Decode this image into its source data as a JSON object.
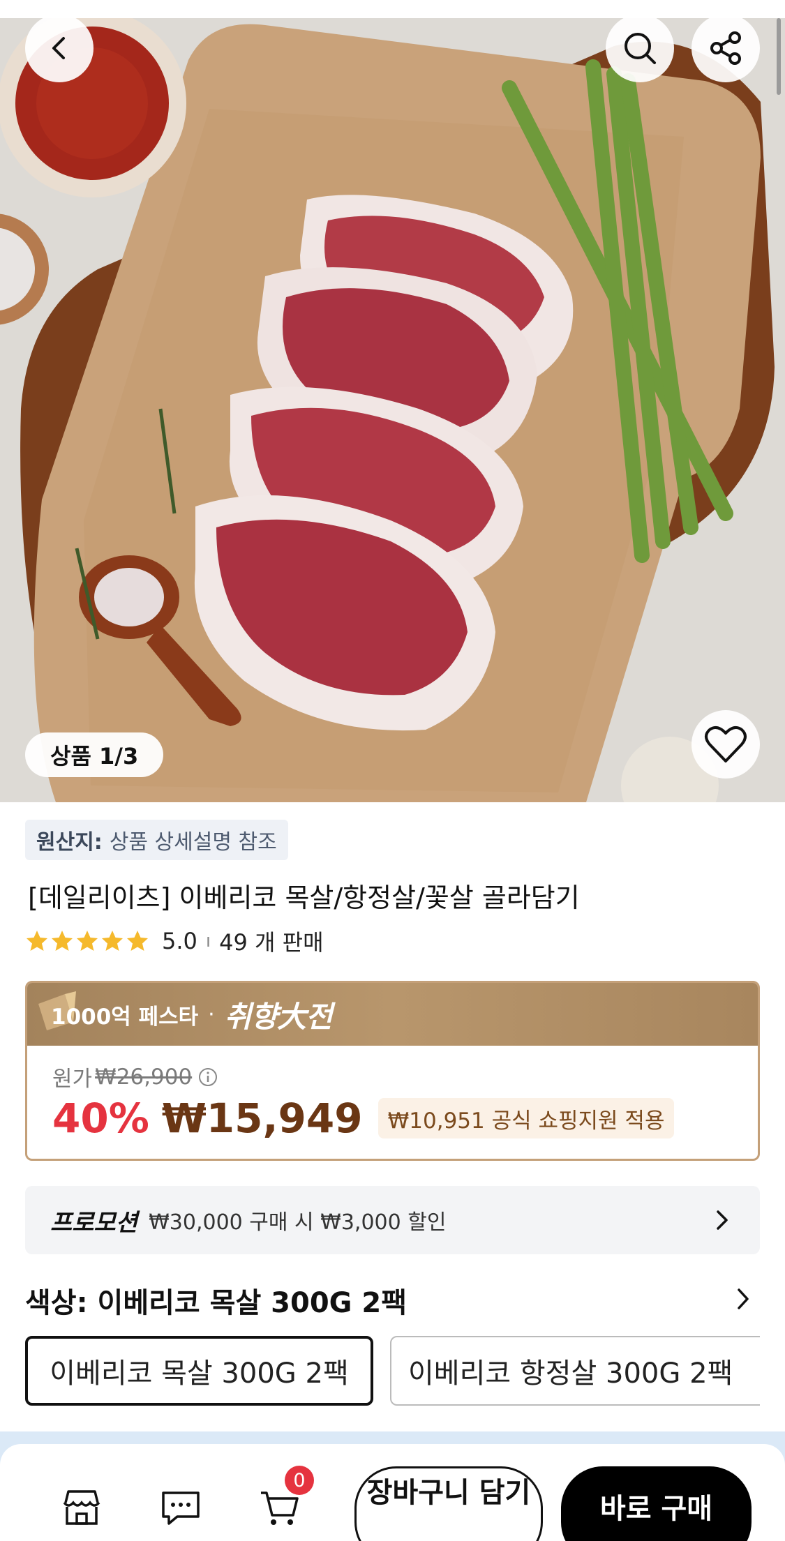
{
  "hero": {
    "counter_label": "상품 1/3"
  },
  "origin": {
    "label": "원산지:",
    "value": "상품 상세설명 참조"
  },
  "product": {
    "title": "[데일리이츠] 이베리코 목살/항정살/꽃살 골라담기",
    "rating": "5.0",
    "rating_stars": 5,
    "sold": "49 개 판매"
  },
  "price": {
    "festival": "1000억 페스타",
    "festival_dot": "·",
    "festival_brand": "취향大전",
    "original_label": "원가",
    "original_price": "₩26,900",
    "discount": "40%",
    "final_price": "₩15,949",
    "support_text": "₩10,951 공식 쇼핑지원 적용"
  },
  "promotion": {
    "label": "프로모션",
    "text": "₩30,000 구매 시 ₩3,000 할인"
  },
  "options": {
    "title": "색상: 이베리코 목살 300G 2팩",
    "items": [
      "이베리코 목살 300G 2팩",
      "이베리코 항정살 300G 2팩"
    ]
  },
  "bottom": {
    "cart_count": "0",
    "add_to_cart": "장바구니 담기",
    "buy_now": "바로 구매"
  },
  "colors": {
    "accent_red": "#e5333f",
    "price_brown": "#6a3614",
    "banner_gold": "#b8966c"
  }
}
